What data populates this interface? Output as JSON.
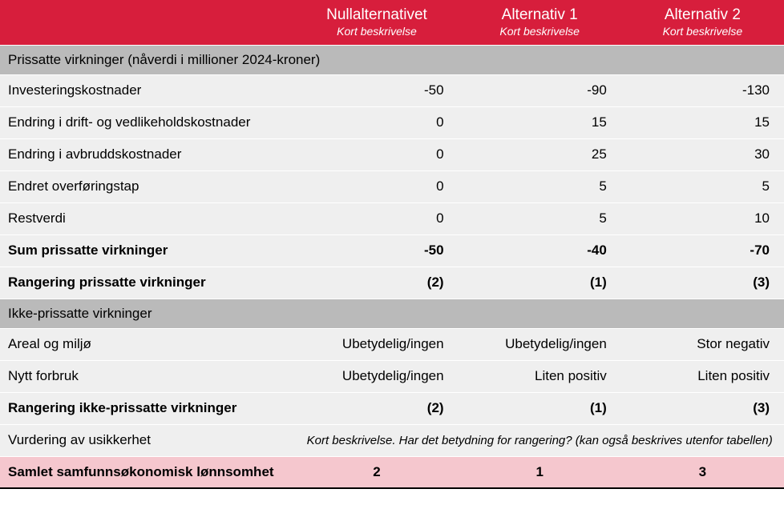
{
  "header": {
    "blank": "",
    "cols": [
      {
        "title": "Nullalternativet",
        "sub": "Kort beskrivelse"
      },
      {
        "title": "Alternativ 1",
        "sub": "Kort beskrivelse"
      },
      {
        "title": "Alternativ 2",
        "sub": "Kort beskrivelse"
      }
    ]
  },
  "section1": {
    "title": "Prissatte virkninger (nåverdi i millioner 2024-kroner)"
  },
  "rows1": [
    {
      "label": "Investeringskostnader",
      "v": [
        "-50",
        "-90",
        "-130"
      ],
      "bold": false
    },
    {
      "label": "Endring i drift- og vedlikeholdskostnader",
      "v": [
        "0",
        "15",
        "15"
      ],
      "bold": false
    },
    {
      "label": "Endring i avbruddskostnader",
      "v": [
        "0",
        "25",
        "30"
      ],
      "bold": false
    },
    {
      "label": "Endret overføringstap",
      "v": [
        "0",
        "5",
        "5"
      ],
      "bold": false
    },
    {
      "label": "Restverdi",
      "v": [
        "0",
        "5",
        "10"
      ],
      "bold": false
    },
    {
      "label": "Sum prissatte virkninger",
      "v": [
        "-50",
        "-40",
        "-70"
      ],
      "bold": true
    },
    {
      "label": "Rangering prissatte virkninger",
      "v": [
        "(2)",
        "(1)",
        "(3)"
      ],
      "bold": true
    }
  ],
  "section2": {
    "title": "Ikke-prissatte virkninger"
  },
  "rows2": [
    {
      "label": "Areal og miljø",
      "v": [
        "Ubetydelig/ingen",
        "Ubetydelig/ingen",
        "Stor negativ"
      ],
      "bold": false
    },
    {
      "label": "Nytt forbruk",
      "v": [
        "Ubetydelig/ingen",
        "Liten positiv",
        "Liten positiv"
      ],
      "bold": false
    },
    {
      "label": "Rangering ikke-prissatte virkninger",
      "v": [
        "(2)",
        "(1)",
        "(3)"
      ],
      "bold": true
    }
  ],
  "uncertainty": {
    "label": "Vurdering av usikkerhet",
    "note": "Kort beskrivelse. Har det betydning for rangering? (kan også beskrives utenfor tabellen)"
  },
  "summary": {
    "label": "Samlet samfunnsøkonomisk lønnsomhet",
    "v": [
      "2",
      "1",
      "3"
    ]
  }
}
